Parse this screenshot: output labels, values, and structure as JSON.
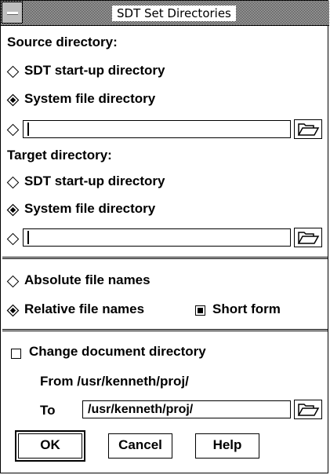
{
  "window": {
    "title": "SDT Set Directories"
  },
  "source": {
    "heading": "Source directory:",
    "options": [
      {
        "label": "SDT start-up directory",
        "selected": false
      },
      {
        "label": "System file directory",
        "selected": true
      }
    ],
    "custom_value": ""
  },
  "target": {
    "heading": "Target directory:",
    "options": [
      {
        "label": "SDT start-up directory",
        "selected": false
      },
      {
        "label": "System file directory",
        "selected": true
      }
    ],
    "custom_value": ""
  },
  "file_names": {
    "options": [
      {
        "label": "Absolute file names",
        "selected": false
      },
      {
        "label": "Relative file names",
        "selected": true
      }
    ],
    "short_form": {
      "label": "Short form",
      "checked": true
    }
  },
  "document": {
    "change_label": "Change document directory",
    "change_checked": false,
    "from_label": "From /usr/kenneth/proj/",
    "to_label": "To",
    "to_value": "/usr/kenneth/proj/"
  },
  "buttons": {
    "ok": "OK",
    "cancel": "Cancel",
    "help": "Help"
  }
}
